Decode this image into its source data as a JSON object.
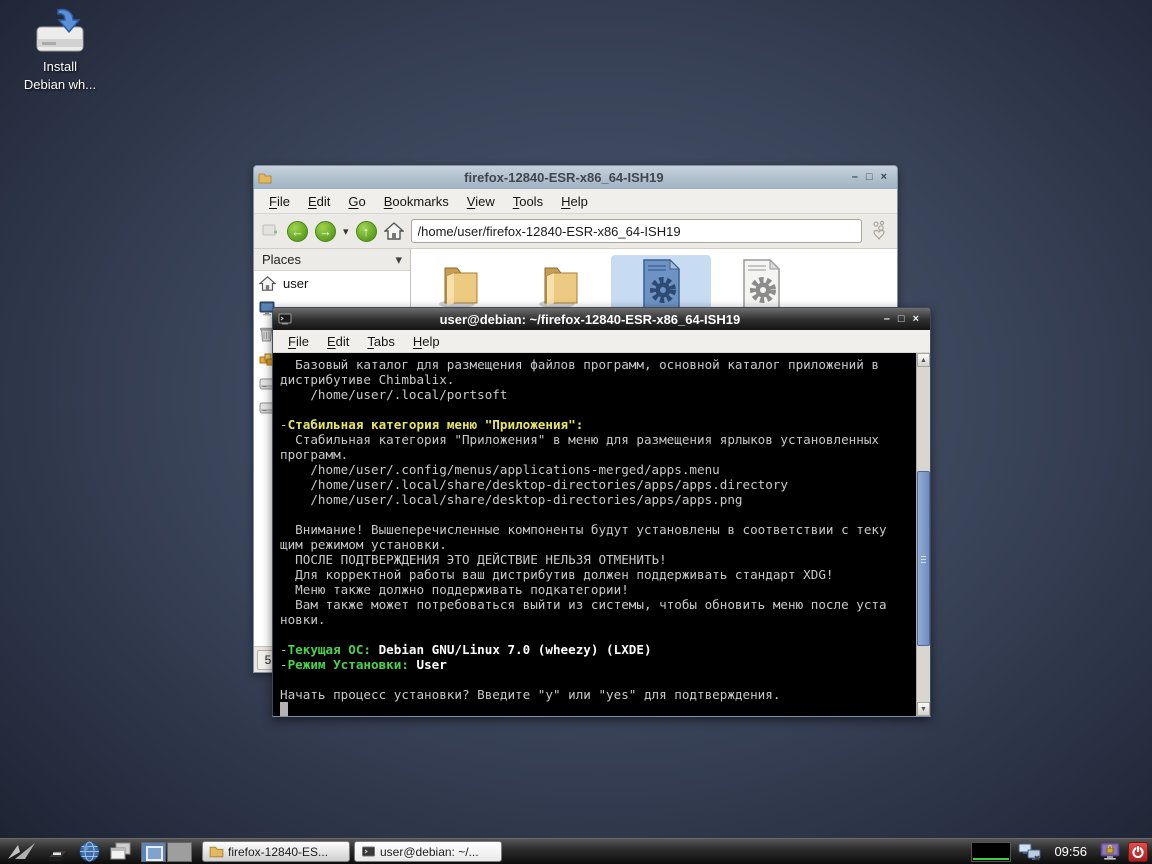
{
  "desktop": {
    "install_icon": {
      "label_line1": "Install",
      "label_line2": "Debian wh..."
    }
  },
  "window_controls": {
    "minimize": "–",
    "maximize": "□",
    "close": "×"
  },
  "icons": {
    "back_arrow": "←",
    "forward_arrow": "→",
    "up_arrow": "↑",
    "chevron_down": "▾",
    "scroll_up": "▲",
    "scroll_down": "▼"
  },
  "file_manager": {
    "title": "firefox-12840-ESR-x86_64-ISH19",
    "menu": [
      "File",
      "Edit",
      "Go",
      "Bookmarks",
      "View",
      "Tools",
      "Help"
    ],
    "address": "/home/user/firefox-12840-ESR-x86_64-ISH19",
    "places_label": "Places",
    "sidebar_items": [
      {
        "icon": "home",
        "label": "user"
      },
      {
        "icon": "desktop",
        "label": ""
      },
      {
        "icon": "trash",
        "label": ""
      },
      {
        "icon": "applications",
        "label": ""
      },
      {
        "icon": "disk",
        "label": ""
      },
      {
        "icon": "disk",
        "label": ""
      }
    ],
    "files": [
      {
        "icon": "folder",
        "selected": false
      },
      {
        "icon": "folder",
        "selected": false
      },
      {
        "icon": "script-blue",
        "selected": true
      },
      {
        "icon": "script-gray",
        "selected": false
      }
    ],
    "status": "5"
  },
  "terminal": {
    "title": "user@debian: ~/firefox-12840-ESR-x86_64-ISH19",
    "menu": [
      "File",
      "Edit",
      "Tabs",
      "Help"
    ],
    "palette": {
      "yellow": "#e9e464",
      "green": "#4bd24b",
      "foreground": "#c9c9c9",
      "background": "#000000"
    },
    "lines": [
      {
        "segs": [
          {
            "t": "  Базовый каталог для размещения файлов программ, основной каталог приложений в"
          }
        ]
      },
      {
        "segs": [
          {
            "t": "дистрибутиве Chimbalix."
          }
        ]
      },
      {
        "segs": [
          {
            "t": "    /home/user/.local/portsoft"
          }
        ]
      },
      {
        "segs": []
      },
      {
        "segs": [
          {
            "t": "-"
          },
          {
            "t": "Стабильная категория меню \"Приложения\":",
            "c": "yellow"
          }
        ]
      },
      {
        "segs": [
          {
            "t": "  Стабильная категория \"Приложения\" в меню для размещения ярлыков установленных"
          }
        ]
      },
      {
        "segs": [
          {
            "t": "программ."
          }
        ]
      },
      {
        "segs": [
          {
            "t": "    /home/user/.config/menus/applications-merged/apps.menu"
          }
        ]
      },
      {
        "segs": [
          {
            "t": "    /home/user/.local/share/desktop-directories/apps/apps.directory"
          }
        ]
      },
      {
        "segs": [
          {
            "t": "    /home/user/.local/share/desktop-directories/apps/apps.png"
          }
        ]
      },
      {
        "segs": []
      },
      {
        "segs": [
          {
            "t": "  Внимание! Вышеперечисленные компоненты будут установлены в соответствии с теку"
          }
        ]
      },
      {
        "segs": [
          {
            "t": "щим режимом установки."
          }
        ]
      },
      {
        "segs": [
          {
            "t": "  ПОСЛЕ ПОДТВЕРЖДЕНИЯ ЭТО ДЕЙСТВИЕ НЕЛЬЗЯ ОТМЕНИТЬ!"
          }
        ]
      },
      {
        "segs": [
          {
            "t": "  Для корректной работы ваш дистрибутив должен поддерживать стандарт XDG!"
          }
        ]
      },
      {
        "segs": [
          {
            "t": "  Меню также должно поддерживать подкатегории!"
          }
        ]
      },
      {
        "segs": [
          {
            "t": "  Вам также может потребоваться выйти из системы, чтобы обновить меню после уста"
          }
        ]
      },
      {
        "segs": [
          {
            "t": "новки."
          }
        ]
      },
      {
        "segs": []
      },
      {
        "segs": [
          {
            "t": "-"
          },
          {
            "t": "Текущая ОС:",
            "c": "green"
          },
          {
            "t": " Debian GNU/Linux 7.0 (wheezy) (LXDE)",
            "c": "whitebold"
          }
        ]
      },
      {
        "segs": [
          {
            "t": "-"
          },
          {
            "t": "Режим Установки:",
            "c": "green"
          },
          {
            "t": " User",
            "c": "whitebold"
          }
        ]
      },
      {
        "segs": []
      },
      {
        "segs": [
          {
            "t": "Начать процесс установки? Введите \"y\" или \"yes\" для подтверждения."
          }
        ]
      },
      {
        "segs": [
          {
            "t": " ",
            "c": "cursor"
          }
        ]
      }
    ]
  },
  "taskbar": {
    "launchers": [
      {
        "icon": "filemanager"
      },
      {
        "icon": "browser"
      },
      {
        "icon": "iconify"
      }
    ],
    "pager": [
      {
        "active": true
      },
      {
        "active": false
      }
    ],
    "tasks": [
      {
        "icon": "folder-small",
        "label": "firefox-12840-ES...",
        "active": false
      },
      {
        "icon": "terminal-small",
        "label": "user@debian: ~/...",
        "active": true
      }
    ],
    "clock": "09:56"
  },
  "colors": {
    "selection_blue": "#c7dbf2",
    "pager_active": "#5b84b8",
    "scroll_thumb": "#7693c8",
    "power_red": "#c43a3a"
  }
}
